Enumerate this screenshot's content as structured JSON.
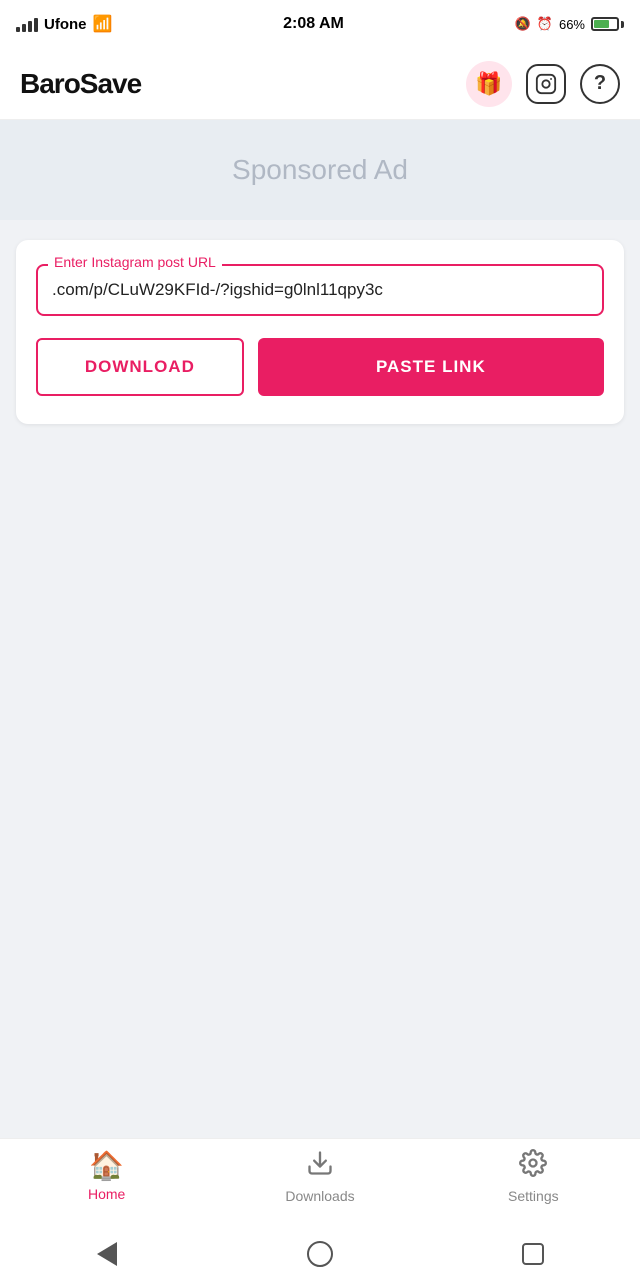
{
  "status_bar": {
    "carrier": "Ufone",
    "time": "2:08 AM",
    "battery_percent": "66%"
  },
  "header": {
    "logo": "BaroSave",
    "gift_icon": "gift-icon",
    "instagram_icon": "instagram-icon",
    "help_icon": "help-icon"
  },
  "ad_banner": {
    "text": "Sponsored Ad"
  },
  "url_section": {
    "label": "Enter Instagram post URL",
    "url_value": ".com/p/CLuW29KFId-/?igshid=g0lnl11qpy3c",
    "download_button": "DOWNLOAD",
    "paste_button": "PASTE LINK"
  },
  "bottom_nav": {
    "items": [
      {
        "id": "home",
        "label": "Home",
        "icon": "🏠",
        "active": true
      },
      {
        "id": "downloads",
        "label": "Downloads",
        "icon": "⬇",
        "active": false
      },
      {
        "id": "settings",
        "label": "Settings",
        "icon": "⚙",
        "active": false
      }
    ]
  }
}
